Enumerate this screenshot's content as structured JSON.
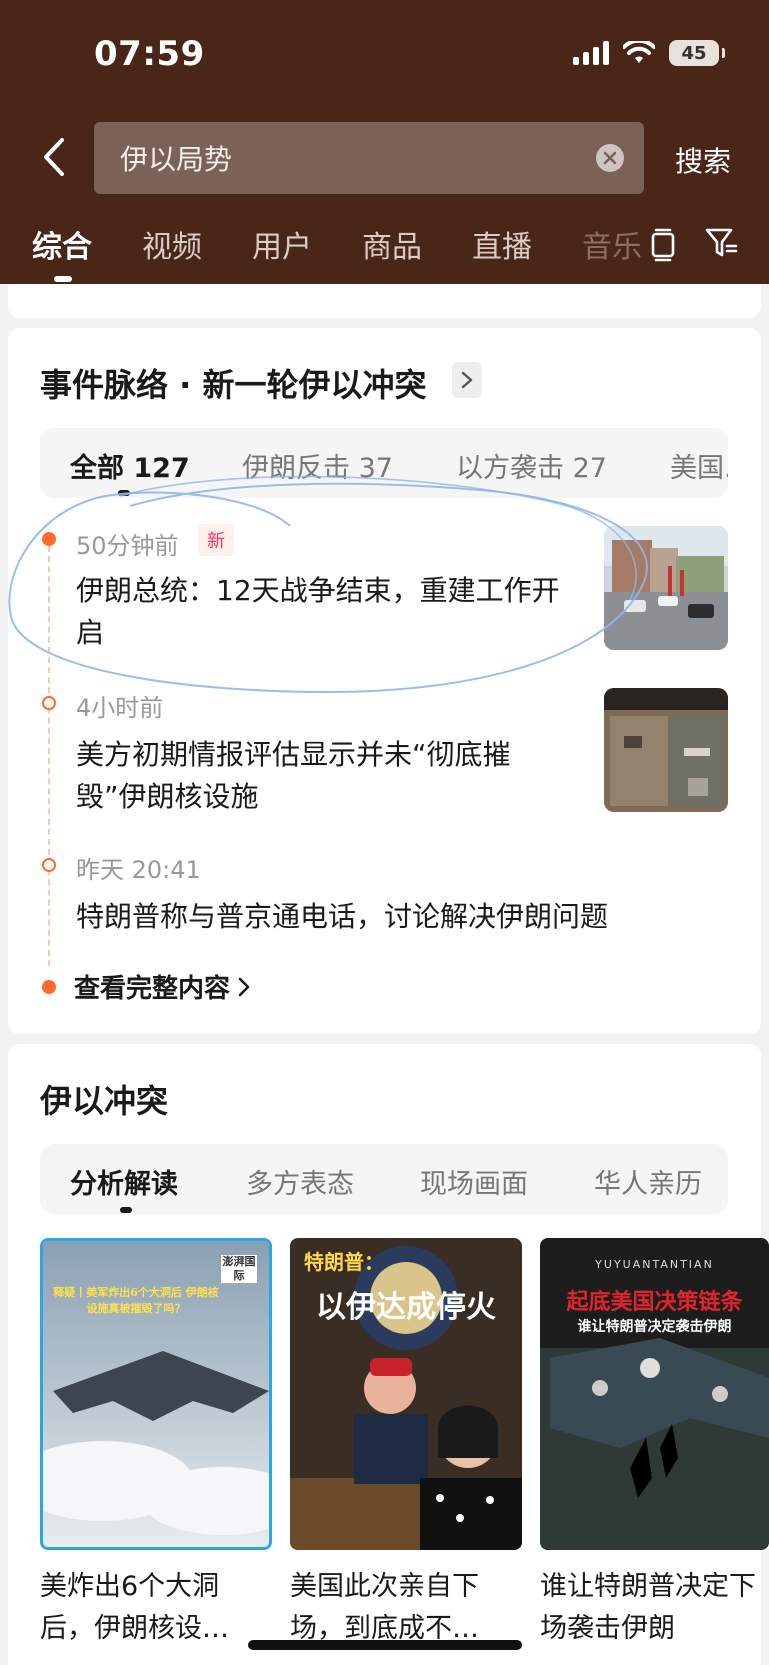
{
  "status_bar": {
    "time": "07:59",
    "battery": "45"
  },
  "search": {
    "query": "伊以局势",
    "button_label": "搜索"
  },
  "tabs": [
    {
      "label": "综合"
    },
    {
      "label": "视频"
    },
    {
      "label": "用户"
    },
    {
      "label": "商品"
    },
    {
      "label": "直播"
    },
    {
      "label": "音乐"
    }
  ],
  "event_section": {
    "title": "事件脉络 · 新一轮伊以冲突",
    "filters": [
      {
        "label": "全部 127"
      },
      {
        "label": "伊朗反击 37"
      },
      {
        "label": "以方袭击 27"
      },
      {
        "label": "美国..."
      }
    ],
    "items": [
      {
        "time": "50分钟前",
        "badge": "新",
        "title": "伊朗总统：12天战争结束，重建工作开启"
      },
      {
        "time": "4小时前",
        "title": "美方初期情报评估显示并未“彻底摧毁”伊朗核设施"
      },
      {
        "time": "昨天 20:41",
        "title": "特朗普称与普京通电话，讨论解决伊朗问题"
      }
    ],
    "view_more": "查看完整内容"
  },
  "conflict_section": {
    "title": "伊以冲突",
    "filters": [
      {
        "label": "分析解读"
      },
      {
        "label": "多方表态"
      },
      {
        "label": "现场画面"
      },
      {
        "label": "华人亲历"
      }
    ],
    "videos": [
      {
        "title": "美炸出6个大洞后，伊朗核设…",
        "overlay_a": "澎湃国际",
        "overlay_b": "释疑丨美军炸出6个大洞后 伊朗核设施真被摧毁了吗？"
      },
      {
        "title": "美国此次亲自下场，到底成不…",
        "overlay_a": "特朗普：",
        "overlay_b": "以伊达成停火"
      },
      {
        "title": "谁让特朗普决定下场袭击伊朗",
        "overlay_a": "YUYUANTANTIAN",
        "overlay_b": "起底美国决策链条",
        "overlay_c": "谁让特朗普决定袭击伊朗"
      }
    ]
  },
  "colors": {
    "header_bg": "#4a2619",
    "accent": "#ff6a2b",
    "badge_red": "#ff3355"
  }
}
